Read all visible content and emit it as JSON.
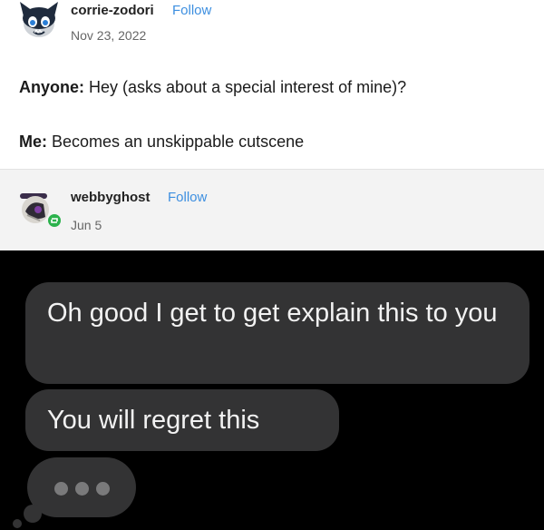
{
  "post": {
    "username": "corrie-zodori",
    "follow_label": "Follow",
    "date": "Nov 23, 2022",
    "lines": [
      {
        "speaker": "Anyone:",
        "text": " Hey (asks about a special interest of mine)?"
      },
      {
        "speaker": "Me:",
        "text": " Becomes an unskippable cutscene"
      }
    ]
  },
  "reblog": {
    "username": "webbyghost",
    "follow_label": "Follow",
    "date": "Jun 5"
  },
  "chat": {
    "messages": [
      "Oh good I get to get explain this to you",
      "You will regret this"
    ],
    "typing_dots": 3
  },
  "colors": {
    "follow": "#3d8fe0",
    "bubble": "#333334",
    "chat_bg": "#000000",
    "reblog_badge": "#2bb24c"
  }
}
